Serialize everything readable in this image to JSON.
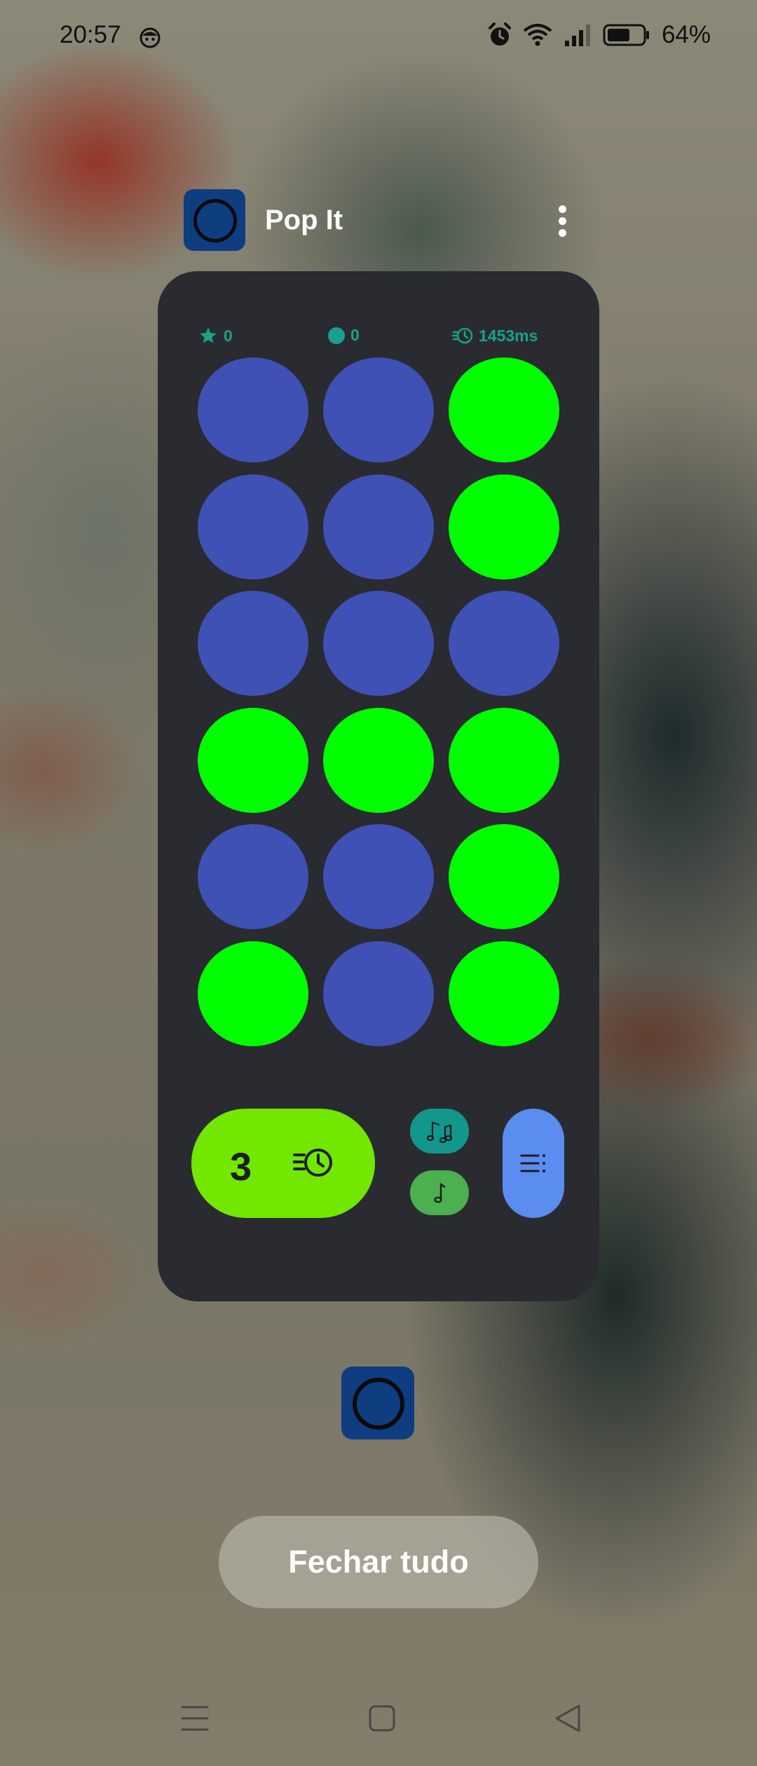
{
  "status_bar": {
    "time": "20:57",
    "battery_percent": "64%",
    "battery_level": 0.64,
    "icons": [
      "face-emoji-icon",
      "alarm-icon",
      "wifi-icon",
      "signal-icon",
      "battery-icon"
    ]
  },
  "app": {
    "title": "Pop It",
    "icon": "pop-it-app-icon",
    "more_icon": "more-vertical-icon"
  },
  "game": {
    "stats": {
      "stars": "0",
      "pops": "0",
      "time": "1453ms"
    },
    "colors": {
      "card_bg": "#2a2b30",
      "bubble_blue": "#3f51b5",
      "bubble_green": "#00ff00",
      "stat_teal": "#1aa08c",
      "timer_green": "#72e800",
      "music_teal": "#13968c",
      "sound_green": "#4caf50",
      "menu_blue": "#5b8cf0"
    },
    "bubbles": [
      [
        "blue",
        "blue",
        "green"
      ],
      [
        "blue",
        "blue",
        "green"
      ],
      [
        "blue",
        "blue",
        "blue"
      ],
      [
        "green",
        "green",
        "green"
      ],
      [
        "blue",
        "blue",
        "green"
      ],
      [
        "green",
        "blue",
        "green"
      ]
    ],
    "controls": {
      "timer_count": "3",
      "timer_icon": "fast-timer-icon",
      "music_icon": "music-notes-icon",
      "sound_icon": "music-note-icon",
      "menu_icon": "menu-list-icon"
    }
  },
  "recents": {
    "close_all_label": "Fechar tudo"
  },
  "nav_bar": {
    "items": [
      "menu-icon",
      "home-icon",
      "back-icon"
    ]
  }
}
